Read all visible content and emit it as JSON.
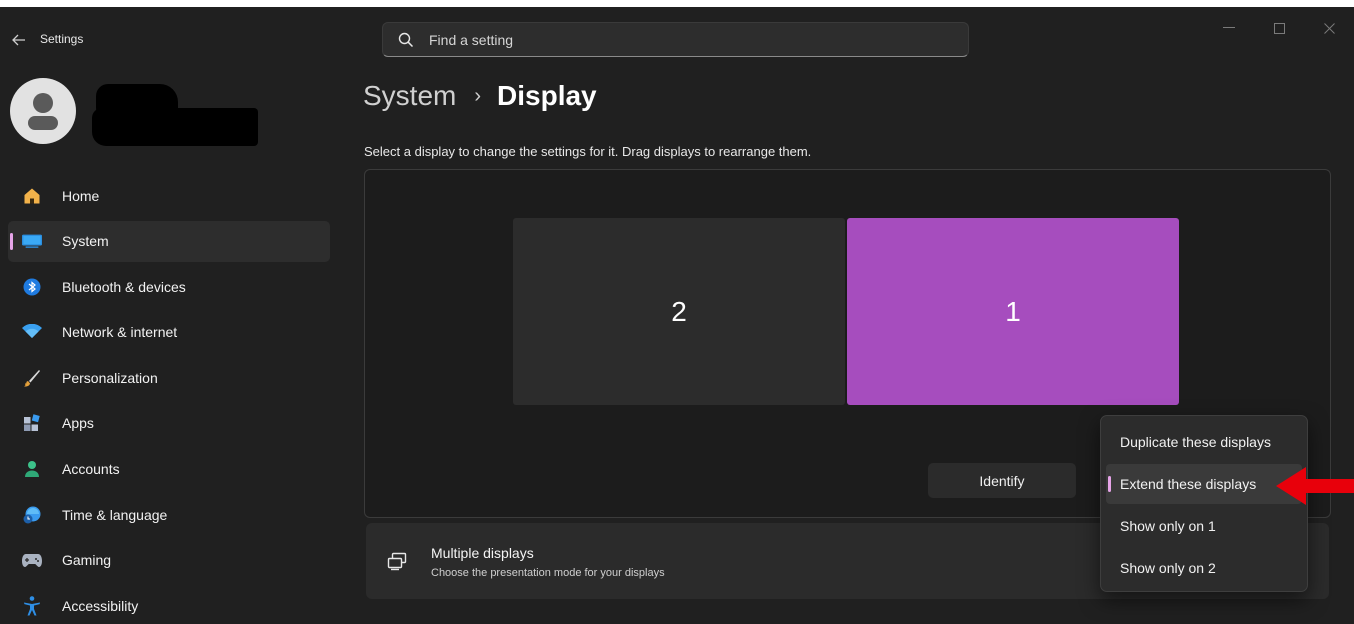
{
  "window": {
    "title": "Settings",
    "back_icon": "back-arrow-icon"
  },
  "search": {
    "placeholder": "Find a setting"
  },
  "sidebar": {
    "items": [
      {
        "label": "Home",
        "icon": "home-icon",
        "active": false
      },
      {
        "label": "System",
        "icon": "system-icon",
        "active": true
      },
      {
        "label": "Bluetooth & devices",
        "icon": "bluetooth-icon",
        "active": false
      },
      {
        "label": "Network & internet",
        "icon": "wifi-icon",
        "active": false
      },
      {
        "label": "Personalization",
        "icon": "brush-icon",
        "active": false
      },
      {
        "label": "Apps",
        "icon": "apps-icon",
        "active": false
      },
      {
        "label": "Accounts",
        "icon": "accounts-icon",
        "active": false
      },
      {
        "label": "Time & language",
        "icon": "globe-clock-icon",
        "active": false
      },
      {
        "label": "Gaming",
        "icon": "gamepad-icon",
        "active": false
      },
      {
        "label": "Accessibility",
        "icon": "accessibility-icon",
        "active": false
      }
    ]
  },
  "main": {
    "breadcrumb_parent": "System",
    "breadcrumb_separator": "›",
    "breadcrumb_current": "Display",
    "subtitle": "Select a display to change the settings for it. Drag displays to rearrange them.",
    "monitors": [
      {
        "number": "2",
        "selected": false
      },
      {
        "number": "1",
        "selected": true
      }
    ],
    "identify_label": "Identify",
    "multiple_displays": {
      "title": "Multiple displays",
      "description": "Choose the presentation mode for your displays"
    }
  },
  "dropdown": {
    "options": [
      "Duplicate these displays",
      "Extend these displays",
      "Show only on 1",
      "Show only on 2"
    ],
    "selected_index": 1
  },
  "colors": {
    "accent": "#e6a4e8",
    "monitor_selected": "#a64dbe",
    "annotation_arrow": "#e8000b"
  }
}
